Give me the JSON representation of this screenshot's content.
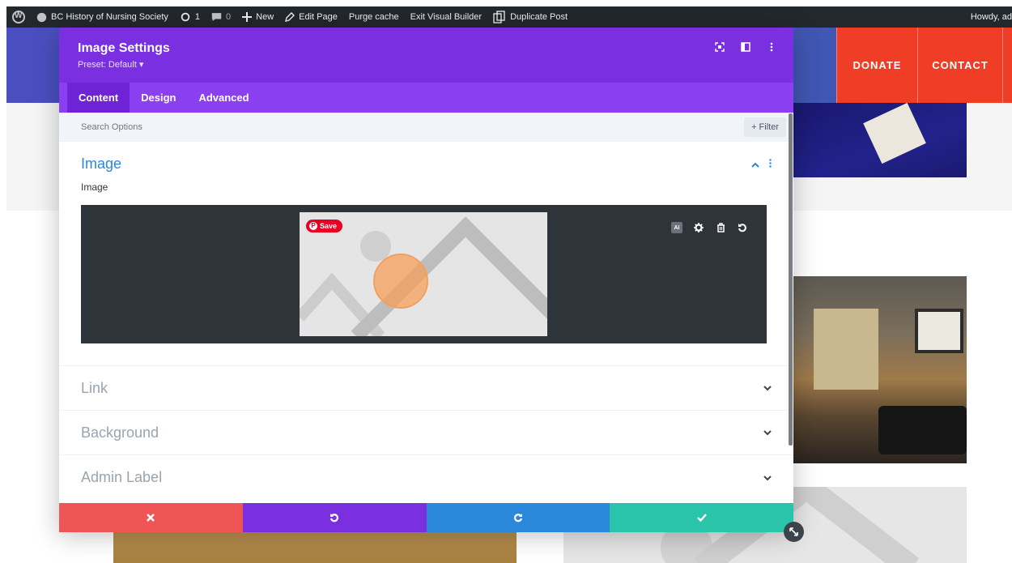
{
  "admin_bar": {
    "site_name": "BC History of Nursing Society",
    "updates_count": "1",
    "comments_count": "0",
    "new_label": "New",
    "edit_page_label": "Edit Page",
    "purge_cache_label": "Purge cache",
    "exit_builder_label": "Exit Visual Builder",
    "duplicate_post_label": "Duplicate Post",
    "howdy_label": "Howdy, ad"
  },
  "site_nav": {
    "donate_label": "DONATE",
    "contact_label": "CONTACT"
  },
  "modal": {
    "title": "Image Settings",
    "preset": "Preset: Default ▾",
    "tabs": [
      {
        "label": "Content",
        "active": true
      },
      {
        "label": "Design",
        "active": false
      },
      {
        "label": "Advanced",
        "active": false
      }
    ],
    "search_placeholder": "Search Options",
    "filter_label": "+ Filter",
    "image_section": {
      "title": "Image",
      "field_label": "Image",
      "pin_save_label": "Save",
      "ai_label": "AI"
    },
    "sections": [
      {
        "title": "Link"
      },
      {
        "title": "Background"
      },
      {
        "title": "Admin Label"
      }
    ]
  },
  "colors": {
    "header_purple": "#7a2fe0",
    "tab_purple": "#8a3ff0",
    "discard_red": "#ef5555",
    "redo_blue": "#2b87da",
    "save_green": "#29c4a9",
    "nav_orange": "#ef3d26"
  }
}
